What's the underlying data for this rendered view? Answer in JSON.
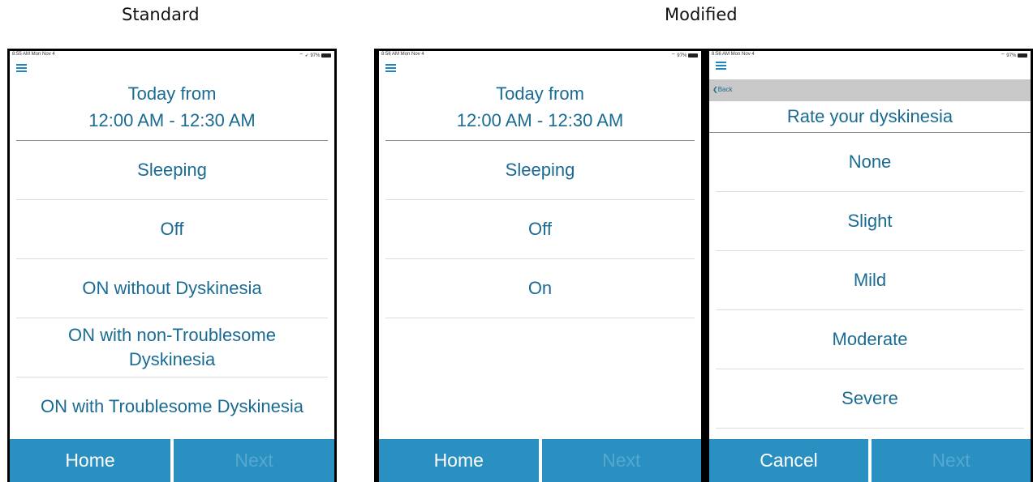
{
  "captions": {
    "standard": "Standard",
    "modified": "Modified"
  },
  "colors": {
    "accent": "#1a6b94",
    "button": "#2a8fc1",
    "backbar": "#c8c8c8"
  },
  "status": {
    "standard": {
      "time": "8:55 AM  Mon Nov 4",
      "right": "⌔ ➶ 97%"
    },
    "modified1": {
      "time": "8:56 AM  Mon Nov 4",
      "right": "⌔ 97%"
    },
    "modified2": {
      "time": "8:56 AM  Mon Nov 4",
      "right": "⌔ 97%"
    }
  },
  "standard": {
    "header_line1": "Today from",
    "header_line2": "12:00 AM - 12:30 AM",
    "options": [
      "Sleeping",
      "Off",
      "ON without Dyskinesia",
      "ON with non-Troublesome Dyskinesia",
      "ON with Troublesome Dyskinesia"
    ],
    "home": "Home",
    "next": "Next"
  },
  "modified1": {
    "header_line1": "Today from",
    "header_line2": "12:00 AM - 12:30 AM",
    "options": [
      "Sleeping",
      "Off",
      "On"
    ],
    "home": "Home",
    "next": "Next"
  },
  "modified2": {
    "back": "Back",
    "title": "Rate your dyskinesia",
    "options": [
      "None",
      "Slight",
      "Mild",
      "Moderate",
      "Severe"
    ],
    "cancel": "Cancel",
    "next": "Next"
  },
  "icons": {
    "menu": "hamburger-menu-icon",
    "back": "chevron-left-icon",
    "wifi": "wifi-icon",
    "battery": "battery-icon"
  }
}
